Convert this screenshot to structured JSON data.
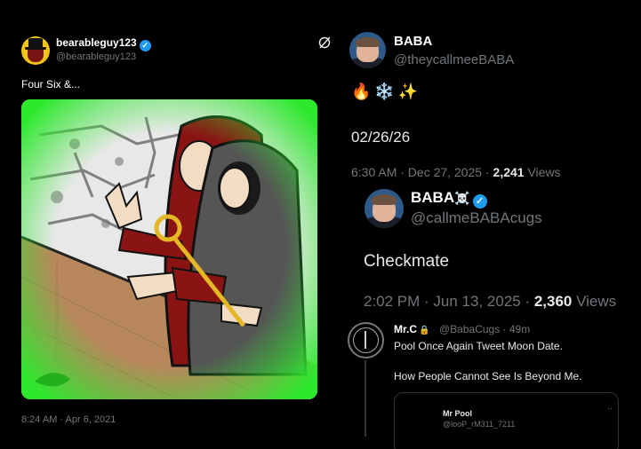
{
  "left_tweet": {
    "display_name": "bearableguy123",
    "handle": "@bearableguy123",
    "text": "Four Six &...",
    "timestamp": "8:24 AM · Apr 6, 2021",
    "icons": [
      "verified-badge-icon",
      "grok-icon"
    ]
  },
  "right_tweet": {
    "display_name": "BABA",
    "handle": "@theycallmeeBABA",
    "emojis": "🔥❄️✨",
    "date_text": "02/26/26",
    "time": "6:30 AM · Dec 27, 2025 · ",
    "views_count": "2,241",
    "views_label": " Views"
  },
  "quoted_tweet": {
    "display_name": "BABA",
    "name_emoji": "☠️",
    "handle": "@callmeBABAcugs",
    "text": "Checkmate",
    "time": "2:02 PM · Jun 13, 2025 · ",
    "views_count": "2,360",
    "views_label": " Views"
  },
  "reply": {
    "display_name": "Mr.C",
    "lock": "🔒",
    "handle_time": "@BabaCugs · 49m",
    "line1": "Pool Once Again Tweet Moon Date.",
    "line2": "How People Cannot See Is Beyond Me.",
    "card_name": "Mr Pool",
    "card_handle": "@looP_rM311_7211",
    "card_dots": "··"
  },
  "colors": {
    "background": "#000000",
    "muted": "#71767b",
    "verified": "#1d9bf0",
    "media_green": "#2ee82e"
  }
}
